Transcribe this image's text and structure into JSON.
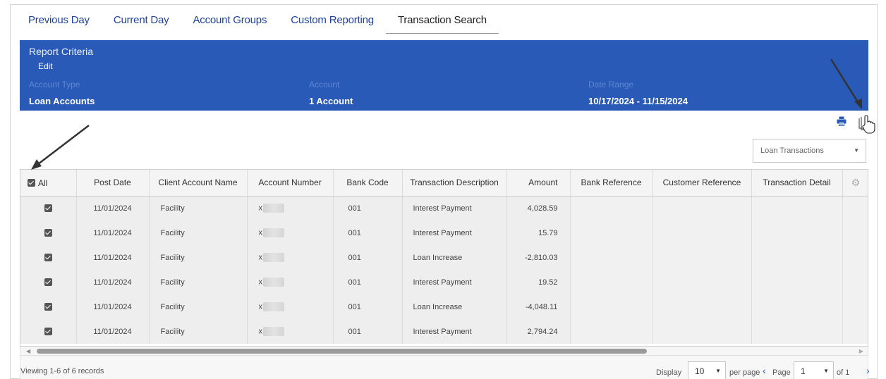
{
  "tabs": [
    {
      "label": "Previous Day"
    },
    {
      "label": "Current Day"
    },
    {
      "label": "Account Groups"
    },
    {
      "label": "Custom Reporting"
    },
    {
      "label": "Transaction Search",
      "active": true
    }
  ],
  "criteria": {
    "title": "Report Criteria",
    "edit_label": "Edit",
    "account_type_label": "Account Type",
    "account_type_value": "Loan Accounts",
    "account_label": "Account",
    "account_value": "1 Account",
    "date_range_label": "Date Range",
    "date_range_value": "10/17/2024 - 11/15/2024"
  },
  "toolbar": {
    "print_icon": "printer-icon",
    "export_icon": "export-icon",
    "view_select_value": "Loan Transactions"
  },
  "grid": {
    "select_all_label": "All",
    "columns": [
      "Post Date",
      "Client Account Name",
      "Account Number",
      "Bank Code",
      "Transaction Description",
      "Amount",
      "Bank Reference",
      "Customer Reference",
      "Transaction Detail"
    ],
    "rows": [
      {
        "post_date": "11/01/2024",
        "client_account_name": "Facility",
        "account_prefix": "x",
        "bank_code": "001",
        "description": "Interest Payment",
        "amount": "4,028.59"
      },
      {
        "post_date": "11/01/2024",
        "client_account_name": "Facility",
        "account_prefix": "x",
        "bank_code": "001",
        "description": "Interest Payment",
        "amount": "15.79"
      },
      {
        "post_date": "11/01/2024",
        "client_account_name": "Facility",
        "account_prefix": "x",
        "bank_code": "001",
        "description": "Loan Increase",
        "amount": "-2,810.03"
      },
      {
        "post_date": "11/01/2024",
        "client_account_name": "Facility",
        "account_prefix": "x",
        "bank_code": "001",
        "description": "Interest Payment",
        "amount": "19.52"
      },
      {
        "post_date": "11/01/2024",
        "client_account_name": "Facility",
        "account_prefix": "x",
        "bank_code": "001",
        "description": "Loan Increase",
        "amount": "-4,048.11"
      },
      {
        "post_date": "11/01/2024",
        "client_account_name": "Facility",
        "account_prefix": "x",
        "bank_code": "001",
        "description": "Interest Payment",
        "amount": "2,794.24"
      }
    ]
  },
  "footer": {
    "viewing_text": "Viewing 1-6 of 6 records",
    "display_label": "Display",
    "per_page_value": "10",
    "per_page_label": "per page",
    "page_label": "Page",
    "page_value": "1",
    "of_label": "of 1"
  },
  "colors": {
    "banner": "#2a5ab7",
    "tab_link": "#21409a"
  }
}
